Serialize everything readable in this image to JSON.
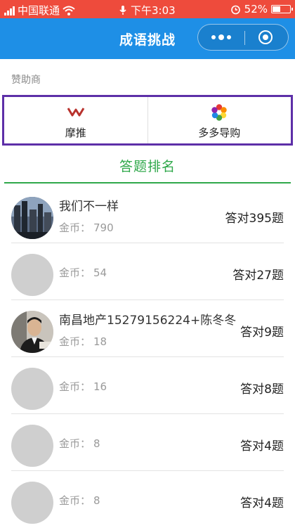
{
  "status_bar": {
    "carrier": "中国联通",
    "time": "下午3:03",
    "battery": "52%",
    "battery_level": 0.52
  },
  "header": {
    "title": "成语挑战"
  },
  "sponsors": {
    "label": "赞助商",
    "items": [
      {
        "name": "摩推",
        "icon": "motui-logo-icon"
      },
      {
        "name": "多多导购",
        "icon": "petal-logo-icon"
      }
    ]
  },
  "ranking": {
    "title": "答题排名",
    "coin_label": "金币：",
    "rows": [
      {
        "name": "我们不一样",
        "coins": "790",
        "score": "答对395题",
        "avatar": "city-photo"
      },
      {
        "name": "",
        "coins": "54",
        "score": "答对27题",
        "avatar": "placeholder"
      },
      {
        "name": "南昌地产15279156224+陈冬冬",
        "coins": "18",
        "score": "答对9题",
        "avatar": "person-photo"
      },
      {
        "name": "",
        "coins": "16",
        "score": "答对8题",
        "avatar": "placeholder"
      },
      {
        "name": "",
        "coins": "8",
        "score": "答对4题",
        "avatar": "placeholder"
      },
      {
        "name": "",
        "coins": "8",
        "score": "答对4题",
        "avatar": "placeholder"
      }
    ]
  },
  "colors": {
    "status_bar": "#ee4b3c",
    "header": "#1e8fe6",
    "sponsor_border": "#5d2fa8",
    "accent_green": "#2fa84a"
  }
}
